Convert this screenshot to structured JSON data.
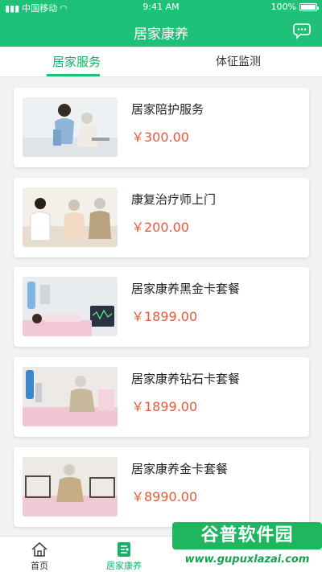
{
  "status_bar": {
    "carrier": "中国移动",
    "time": "9:41 AM",
    "battery": "100%"
  },
  "nav": {
    "title": "居家康养",
    "chat_icon": "chat-bubble-icon"
  },
  "tabs": [
    {
      "label": "居家服务",
      "active": true
    },
    {
      "label": "体征监测",
      "active": false
    }
  ],
  "services": [
    {
      "title": "居家陪护服务",
      "price": "￥300.00"
    },
    {
      "title": "康复治疗师上门",
      "price": "￥200.00"
    },
    {
      "title": "居家康养黑金卡套餐",
      "price": "￥1899.00"
    },
    {
      "title": "居家康养钻石卡套餐",
      "price": "￥1899.00"
    },
    {
      "title": "居家康养金卡套餐",
      "price": "￥8990.00"
    }
  ],
  "tab_bar": [
    {
      "label": "首页",
      "icon": "home-icon",
      "active": false
    },
    {
      "label": "居家康养",
      "icon": "home-care-icon",
      "active": true
    }
  ],
  "watermark": {
    "brand": "谷普软件园",
    "url": "www.gupuxlazai.com"
  },
  "colors": {
    "brand_green": "#1fc178",
    "price_red": "#e35b3a"
  }
}
